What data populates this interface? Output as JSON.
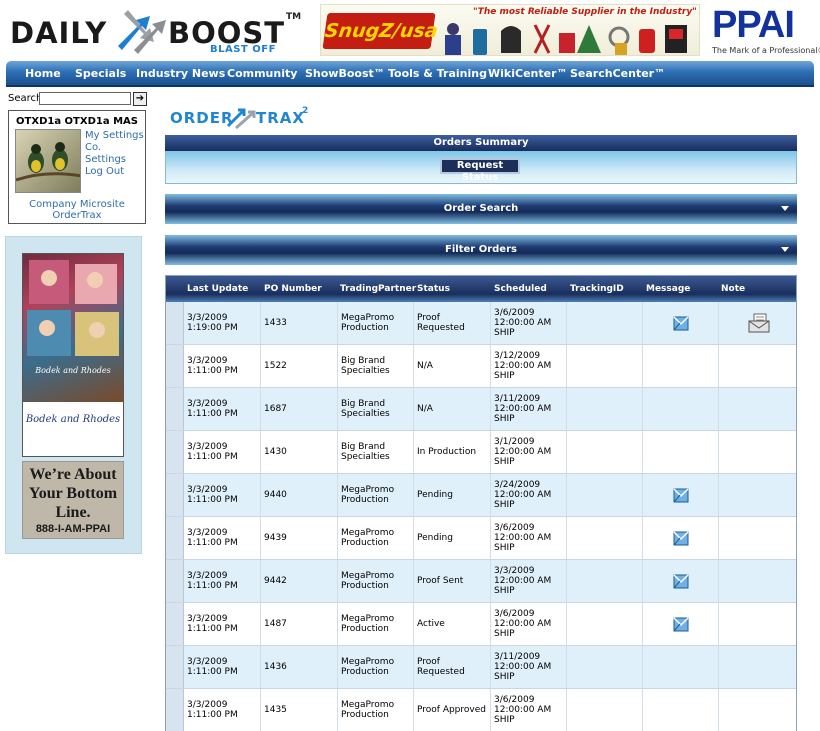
{
  "header": {
    "logo_left": "DAILY",
    "logo_right": "BOOST",
    "logo_tm": "TM",
    "logo_tagline": "BLAST OFF",
    "banner_brand": "SnugZ/usa",
    "banner_tagline": "\"The most Reliable Supplier in the Industry\"",
    "ppai_logo": "PPAI",
    "ppai_tagline": "The Mark of a Professional®"
  },
  "nav": {
    "items": [
      "Home",
      "Specials",
      "Industry News",
      "Community",
      "ShowBoost™",
      "Tools & Training",
      "WikiCenter™",
      "SearchCenter™"
    ]
  },
  "sidebar": {
    "search_label": "Search",
    "search_value": "",
    "search_go": "➔",
    "user_name": "OTXD1a OTXD1a MAS",
    "links": [
      "My Settings",
      "Co. Settings",
      "Log Out"
    ],
    "bottom_links": [
      "Company Microsite",
      "OrderTrax"
    ],
    "ad_catalog_brand": "Bodek and Rhodes",
    "ad_ppai_lines": [
      "We’re About",
      "Your Bottom",
      "Line."
    ],
    "ad_ppai_phone": "888-I-AM-PPAI"
  },
  "main": {
    "logo_word": "ORDER",
    "logo_word2": "TRAX",
    "logo_sup": "2",
    "orders_summary": "Orders Summary",
    "request_status": "Request Status",
    "order_search": "Order Search",
    "filter_orders": "Filter Orders",
    "columns": [
      "Last Update",
      "PO Number",
      "TradingPartner",
      "Status",
      "Scheduled",
      "TrackingID",
      "Message",
      "Note"
    ],
    "rows": [
      {
        "date": "3/3/2009",
        "time": "1:19:00 PM",
        "po": "1433",
        "partner1": "MegaPromo",
        "partner2": "Production",
        "status1": "Proof",
        "status2": "Requested",
        "sched_date": "3/6/2009",
        "sched_time": "12:00:00 AM",
        "sched_type": "SHIP",
        "tracking": "",
        "message": true,
        "note": true
      },
      {
        "date": "3/3/2009",
        "time": "1:11:00 PM",
        "po": "1522",
        "partner1": "Big Brand",
        "partner2": "Specialties",
        "status1": "N/A",
        "status2": "",
        "sched_date": "3/12/2009",
        "sched_time": "12:00:00 AM",
        "sched_type": "SHIP",
        "tracking": "",
        "message": false,
        "note": false
      },
      {
        "date": "3/3/2009",
        "time": "1:11:00 PM",
        "po": "1687",
        "partner1": "Big Brand",
        "partner2": "Specialties",
        "status1": "N/A",
        "status2": "",
        "sched_date": "3/11/2009",
        "sched_time": "12:00:00 AM",
        "sched_type": "SHIP",
        "tracking": "",
        "message": false,
        "note": false
      },
      {
        "date": "3/3/2009",
        "time": "1:11:00 PM",
        "po": "1430",
        "partner1": "Big Brand",
        "partner2": "Specialties",
        "status1": "In Production",
        "status2": "",
        "sched_date": "3/1/2009",
        "sched_time": "12:00:00 AM",
        "sched_type": "SHIP",
        "tracking": "",
        "message": false,
        "note": false
      },
      {
        "date": "3/3/2009",
        "time": "1:11:00 PM",
        "po": "9440",
        "partner1": "MegaPromo",
        "partner2": "Production",
        "status1": "Pending",
        "status2": "",
        "sched_date": "3/24/2009",
        "sched_time": "12:00:00 AM",
        "sched_type": "SHIP",
        "tracking": "",
        "message": true,
        "note": false
      },
      {
        "date": "3/3/2009",
        "time": "1:11:00 PM",
        "po": "9439",
        "partner1": "MegaPromo",
        "partner2": "Production",
        "status1": "Pending",
        "status2": "",
        "sched_date": "3/6/2009",
        "sched_time": "12:00:00 AM",
        "sched_type": "SHIP",
        "tracking": "",
        "message": true,
        "note": false
      },
      {
        "date": "3/3/2009",
        "time": "1:11:00 PM",
        "po": "9442",
        "partner1": "MegaPromo",
        "partner2": "Production",
        "status1": "Proof Sent",
        "status2": "",
        "sched_date": "3/3/2009",
        "sched_time": "12:00:00 AM",
        "sched_type": "SHIP",
        "tracking": "",
        "message": true,
        "note": false
      },
      {
        "date": "3/3/2009",
        "time": "1:11:00 PM",
        "po": "1487",
        "partner1": "MegaPromo",
        "partner2": "Production",
        "status1": "Active",
        "status2": "",
        "sched_date": "3/6/2009",
        "sched_time": "12:00:00 AM",
        "sched_type": "SHIP",
        "tracking": "",
        "message": true,
        "note": false
      },
      {
        "date": "3/3/2009",
        "time": "1:11:00 PM",
        "po": "1436",
        "partner1": "MegaPromo",
        "partner2": "Production",
        "status1": "Proof",
        "status2": "Requested",
        "sched_date": "3/11/2009",
        "sched_time": "12:00:00 AM",
        "sched_type": "SHIP",
        "tracking": "",
        "message": false,
        "note": false
      },
      {
        "date": "3/3/2009",
        "time": "1:11:00 PM",
        "po": "1435",
        "partner1": "MegaPromo",
        "partner2": "Production",
        "status1": "Proof Approved",
        "status2": "",
        "sched_date": "3/6/2009",
        "sched_time": "12:00:00 AM",
        "sched_type": "SHIP",
        "tracking": "",
        "message": false,
        "note": false
      }
    ]
  },
  "colors": {
    "nav_blue": "#2d6fb5",
    "link_blue": "#2e6cb0",
    "accent_blue": "#1f86cf",
    "table_header": "#1a2e5c",
    "row_alt": "#e0f0fa"
  },
  "icons": {
    "message": "envelope-icon",
    "note": "note-envelope-icon",
    "search_go": "arrow-right-icon"
  }
}
